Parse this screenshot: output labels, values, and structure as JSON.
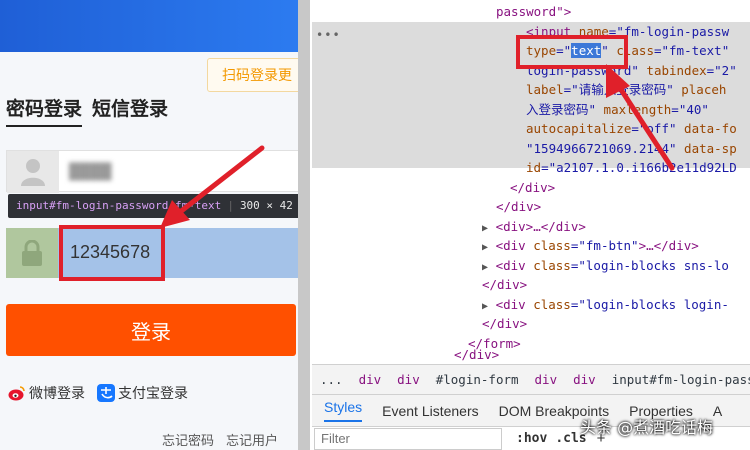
{
  "login": {
    "qr_tip": "扫码登录更",
    "tabs": [
      {
        "label": "密码登录"
      },
      {
        "label": "短信登录"
      }
    ],
    "username_value": "████",
    "tooltip": {
      "selector": "input#fm-login-password.fm-text",
      "size": "300 × 42"
    },
    "password_value": "12345678",
    "login_button": "登录",
    "socials": [
      {
        "label": "微博登录",
        "icon": "weibo-icon",
        "color": "#e6162d"
      },
      {
        "label": "支付宝登录",
        "icon": "alipay-icon",
        "color": "#1677ff"
      }
    ],
    "forgot_password": "忘记密码",
    "forgot_user": "忘记用户"
  },
  "devtools": {
    "lines": {
      "l0": "password\">",
      "l1a": "<input ",
      "l1b": "name",
      "l1c": "=\"fm-login-passw",
      "l2a": "type",
      "l2b": "=\"",
      "l2c": "text",
      "l2d": "\"",
      "l2e": " class",
      "l2f": "=\"fm-text\"",
      "l3a": "login-password\"",
      "l3b": " tabindex",
      "l3c": "=\"2\"",
      "l4a": "label",
      "l4b": "=\"请输入登录密码\"",
      "l4c": " placeh",
      "l5": "入登录密码\"",
      "l5b": " maxlength",
      "l5c": "=\"40\"",
      "l6a": "autocapitalize",
      "l6b": "=\"off\"",
      "l6c": " data-fo",
      "l7": "\"1594966721069.2144\"",
      "l7b": " data-sp",
      "l8a": "id",
      "l8b": "=\"a2107.1.0.i1",
      "l8c": "66b2e11d92LD",
      "l9": "</div>",
      "l10": "</div>",
      "l11": "<div>…</div>",
      "l12a": "<div ",
      "l12b": "class",
      "l12c": "=\"fm-btn\"",
      "l12d": ">…</div>",
      "l13a": "<div ",
      "l13b": "class",
      "l13c": "=\"login-blocks sns-lo",
      "l14": "</div>",
      "l15a": "<div ",
      "l15b": "class",
      "l15c": "=\"login-blocks login-",
      "l16": "</div>",
      "l17": "</form>",
      "l18": "</div>"
    },
    "dots": "•••",
    "breadcrumbs": [
      "...",
      "div",
      "div",
      "#login-form",
      "div",
      "div",
      "input#fm-login-passwo"
    ],
    "tabs": [
      {
        "label": "Styles",
        "active": true
      },
      {
        "label": "Event Listeners"
      },
      {
        "label": "DOM Breakpoints"
      },
      {
        "label": "Properties"
      },
      {
        "label": "A"
      }
    ],
    "filter_placeholder": "Filter",
    "hov": ":hov",
    "cls": ".cls",
    "plus": "+"
  },
  "watermark": "头条 @煮酒吃话梅",
  "colors": {
    "accent": "#ff5000",
    "highlight": "#e0202a",
    "selection": "#a4c2e8"
  }
}
